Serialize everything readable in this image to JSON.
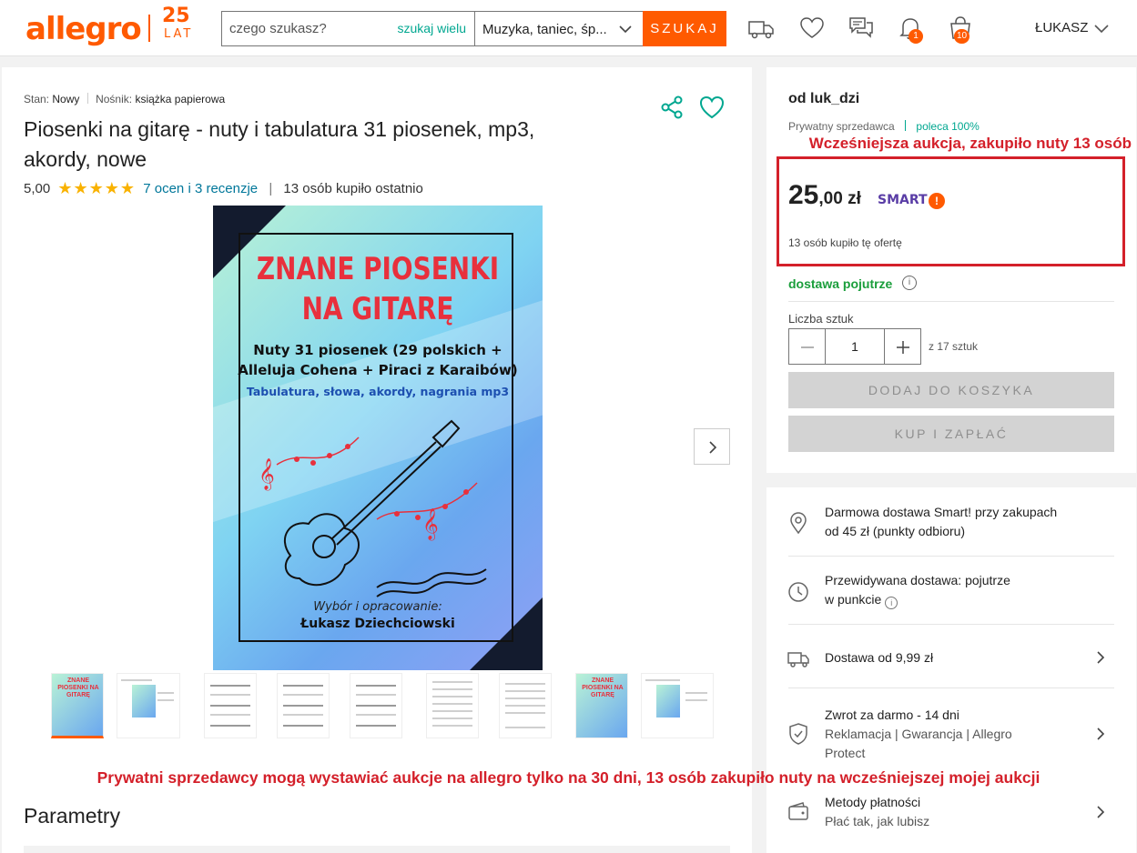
{
  "header": {
    "logo": "allegro",
    "logo_25": "25",
    "logo_lat": "LAT",
    "search_placeholder": "czego szukasz?",
    "search_multi": "szukaj wielu",
    "category": "Muzyka, taniec, śp...",
    "search_button": "SZUKAJ",
    "notifications_count": "1",
    "cart_count": "10",
    "user": "ŁUKASZ",
    "accent": "#ff5a00"
  },
  "product": {
    "condition_label": "Stan:",
    "condition": "Nowy",
    "medium_label": "Nośnik:",
    "medium": "książka papierowa",
    "title": "Piosenki na gitarę - nuty i tabulatura 31 piosenek, mp3, akordy, nowe",
    "rating": "5,00",
    "stars": "★★★★★",
    "reviews": "7 ocen i 3 recenzje",
    "recent_buyers": "13 osób kupiło ostatnio",
    "cover": {
      "title_line1": "ZNANE PIOSENKI",
      "title_line2": "NA GITARĘ",
      "subtitle": "Nuty 31 piosenek (29 polskich + Alleluja Cohena + Piraci z Karaibów)",
      "subtitle2": "Tabulatura, słowa, akordy, nagrania mp3",
      "by_label": "Wybór i opracowanie:",
      "author": "Łukasz Dziechciowski"
    },
    "thumbnail_count": 9,
    "parameters_title": "Parametry"
  },
  "offer": {
    "seller": "od luk_dzi",
    "seller_type": "Prywatny sprzedawca",
    "recommend": "poleca 100%",
    "price_int": "25",
    "price_dec": ",00 zł",
    "smart_label": "SMART",
    "bought": "13 osób kupiło tę ofertę",
    "delivery": "dostawa pojutrze",
    "qty_label": "Liczba sztuk",
    "qty_value": "1",
    "qty_of": "z 17 sztuk",
    "add_to_cart": "DODAJ DO KOSZYKA",
    "buy_now": "KUP I ZAPŁAĆ"
  },
  "delivery_info": [
    {
      "icon": "location-pin-icon",
      "line1": "Darmowa dostawa Smart! przy zakupach",
      "line2": "od 45 zł (punkty odbioru)"
    },
    {
      "icon": "clock-icon",
      "line1": "Przewidywana dostawa: pojutrze",
      "line2": "w punkcie"
    },
    {
      "icon": "truck-icon",
      "line1": "Dostawa od 9,99 zł"
    },
    {
      "icon": "shield-icon",
      "line1": "Zwrot za darmo - 14 dni",
      "line2": "Reklamacja | Gwarancja | Allegro",
      "line3": "Protect"
    },
    {
      "icon": "wallet-icon",
      "line1": "Metody płatności",
      "line2": "Płać tak, jak lubisz"
    }
  ],
  "annotations": {
    "top": "Wcześniejsza aukcja, zakupiło nuty 13 osób",
    "bottom": "Prywatni sprzedawcy mogą wystawiać aukcje na allegro tylko na 30 dni, 13 osób zakupiło nuty na wcześniejszej mojej aukcji",
    "color": "#d4202a"
  }
}
